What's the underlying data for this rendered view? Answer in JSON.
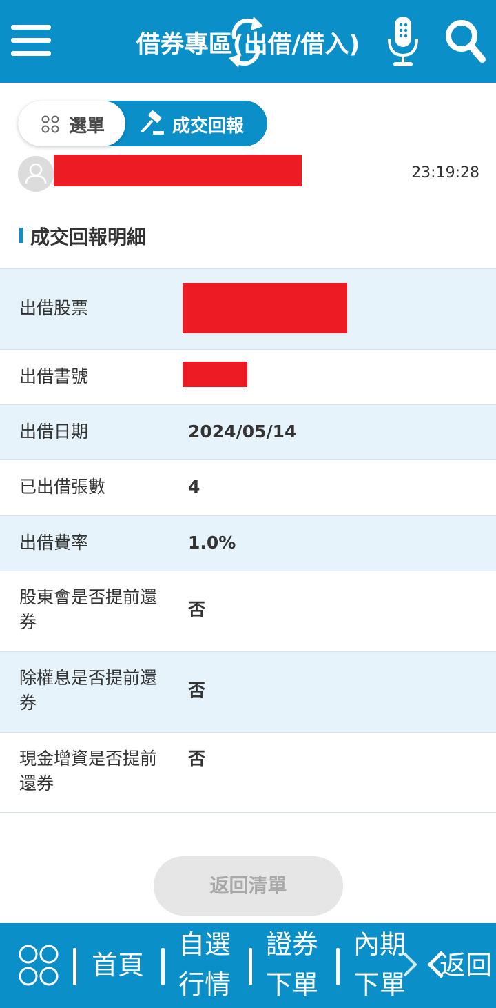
{
  "header": {
    "title": "借券專區(出借/借入)",
    "menu_icon": "hamburger-menu-icon",
    "swap_icon": "refresh-arrows-icon",
    "mic_icon": "microphone-icon",
    "search_icon": "search-icon",
    "background": "#0a8fc8"
  },
  "tabs": [
    {
      "label": "選單",
      "icon": "grid-icon",
      "active": false
    },
    {
      "label": "成交回報",
      "icon": "gavel-icon",
      "active": true
    }
  ],
  "account": {
    "avatar_icon": "user-avatar-icon",
    "name": "[redacted]",
    "time": "23:19:28"
  },
  "section": {
    "title": "成交回報明細"
  },
  "details": [
    {
      "label": "出借股票",
      "value": "[redacted]"
    },
    {
      "label": "出借書號",
      "value": "[redacted]"
    },
    {
      "label": "出借日期",
      "value": "2024/05/14"
    },
    {
      "label": "已出借張數",
      "value": "4"
    },
    {
      "label": "出借費率",
      "value": "1.0%"
    },
    {
      "label": "股東會是否提前還券",
      "value": "否"
    },
    {
      "label": "除權息是否提前還券",
      "value": "否"
    },
    {
      "label": "現金增資是否提前還券",
      "value": "否"
    }
  ],
  "actions": {
    "back_to_list": "返回清單"
  },
  "bottom_nav": {
    "apps_icon": "apps-grid-icon",
    "items": [
      {
        "label": "首頁"
      },
      {
        "label": "自選行情"
      },
      {
        "label": "證券下單"
      },
      {
        "label": "內期下單"
      }
    ],
    "more_icon": "chevron-right-icon",
    "back_icon": "chevron-left-icon",
    "back_label": "返回"
  },
  "colors": {
    "brand": "#0a8fc8",
    "row_shade": "#e6f3fa",
    "redaction": "#ed1c24"
  }
}
